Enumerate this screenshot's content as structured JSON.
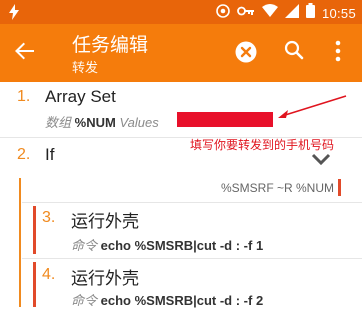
{
  "status_bar": {
    "time": "10:55"
  },
  "app_bar": {
    "title": "任务编辑",
    "subtitle": "转发"
  },
  "actions": [
    {
      "index": "1.",
      "name": "Array Set",
      "arg_label": "数组",
      "arg_value": "%NUM",
      "arg_extra": "Values"
    },
    {
      "index": "2.",
      "name": "If",
      "condition": "%SMSRF ~R %NUM"
    },
    {
      "index": "3.",
      "name": "运行外壳",
      "arg_label": "命令",
      "arg_value": "echo %SMSRB|cut -d : -f 1"
    },
    {
      "index": "4.",
      "name": "运行外壳",
      "arg_label": "命令",
      "arg_value": "echo %SMSRB|cut -d : -f 2"
    }
  ],
  "annotation": {
    "text": "填写你要转发到的手机号码",
    "color": "#e0141e"
  },
  "colors": {
    "status_bar": "#e8650a",
    "app_bar": "#f57c0c",
    "accent": "#f08a1f",
    "redaction": "#e8102a"
  }
}
